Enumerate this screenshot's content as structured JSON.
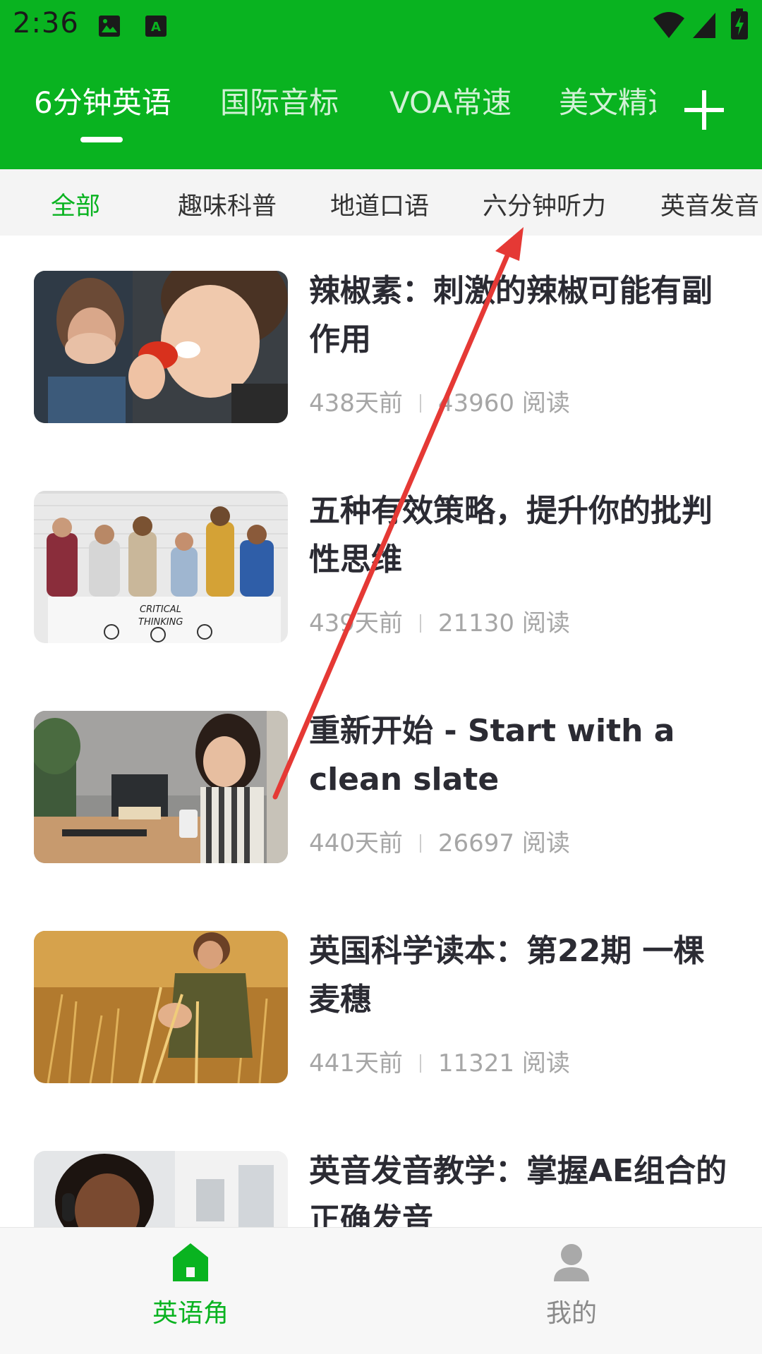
{
  "status_bar": {
    "time": "2:36"
  },
  "tabs": [
    {
      "label": "6分钟英语",
      "active": true
    },
    {
      "label": "国际音标",
      "active": false
    },
    {
      "label": "VOA常速",
      "active": false
    },
    {
      "label": "美文精选",
      "active": false
    }
  ],
  "add_button": {
    "icon": "plus-icon"
  },
  "categories": [
    {
      "label": "全部",
      "active": true
    },
    {
      "label": "趣味科普",
      "active": false
    },
    {
      "label": "地道口语",
      "active": false
    },
    {
      "label": "六分钟听力",
      "active": false
    },
    {
      "label": "英音发音",
      "active": false
    }
  ],
  "articles": [
    {
      "title": "辣椒素：刺激的辣椒可能有副作用",
      "age": "438天前",
      "reads": "43960 阅读",
      "thumbnail": "woman eating red chili pepper"
    },
    {
      "title": "五种有效策略，提升你的批判性思维",
      "age": "439天前",
      "reads": "21130 阅读",
      "thumbnail": "group drawing critical thinking poster"
    },
    {
      "title": "重新开始 - Start with a clean slate",
      "age": "440天前",
      "reads": "26697 阅读",
      "thumbnail": "woman with glasses using phone at desk"
    },
    {
      "title": "英国科学读本：第22期 一棵麦穗",
      "age": "441天前",
      "reads": "11321 阅读",
      "thumbnail": "woman in wheat field"
    },
    {
      "title": "英音发音教学：掌握AE组合的正确发音",
      "age": "",
      "reads": "",
      "thumbnail": "smiling woman with headphones"
    }
  ],
  "bottom_nav": [
    {
      "label": "英语角",
      "icon": "home-icon",
      "active": true
    },
    {
      "label": "我的",
      "icon": "person-icon",
      "active": false
    }
  ],
  "colors": {
    "brand_green": "#09B320",
    "annotation_red": "#E53935"
  }
}
